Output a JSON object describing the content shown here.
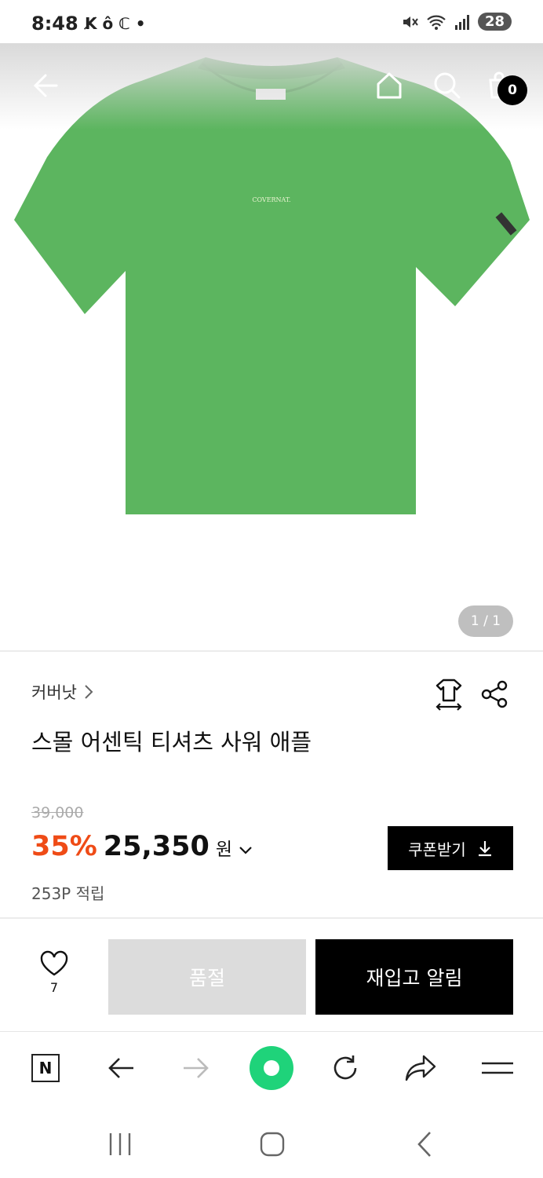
{
  "status_bar": {
    "time": "8:48",
    "left_icons": "K̸ ô ℂ •",
    "battery": "28"
  },
  "header": {
    "cart_count": "0"
  },
  "product_image": {
    "shirt_color": "#5cb55f",
    "chest_logo": "COVERNAT.",
    "image_counter": "1 / 1"
  },
  "product": {
    "brand": "커버낫",
    "title": "스몰 어센틱 티셔츠 사워 애플",
    "original_price": "39,000",
    "discount": "35%",
    "price": "25,350",
    "currency": "원",
    "coupon_label": "쿠폰받기",
    "points": "253P 적립"
  },
  "actions": {
    "like_count": "7",
    "soldout_label": "품절",
    "restock_label": "재입고 알림"
  },
  "browser_bar": {
    "n_label": "N"
  },
  "colors": {
    "discount": "#ef4b16",
    "accent_green": "#1fd37a"
  }
}
